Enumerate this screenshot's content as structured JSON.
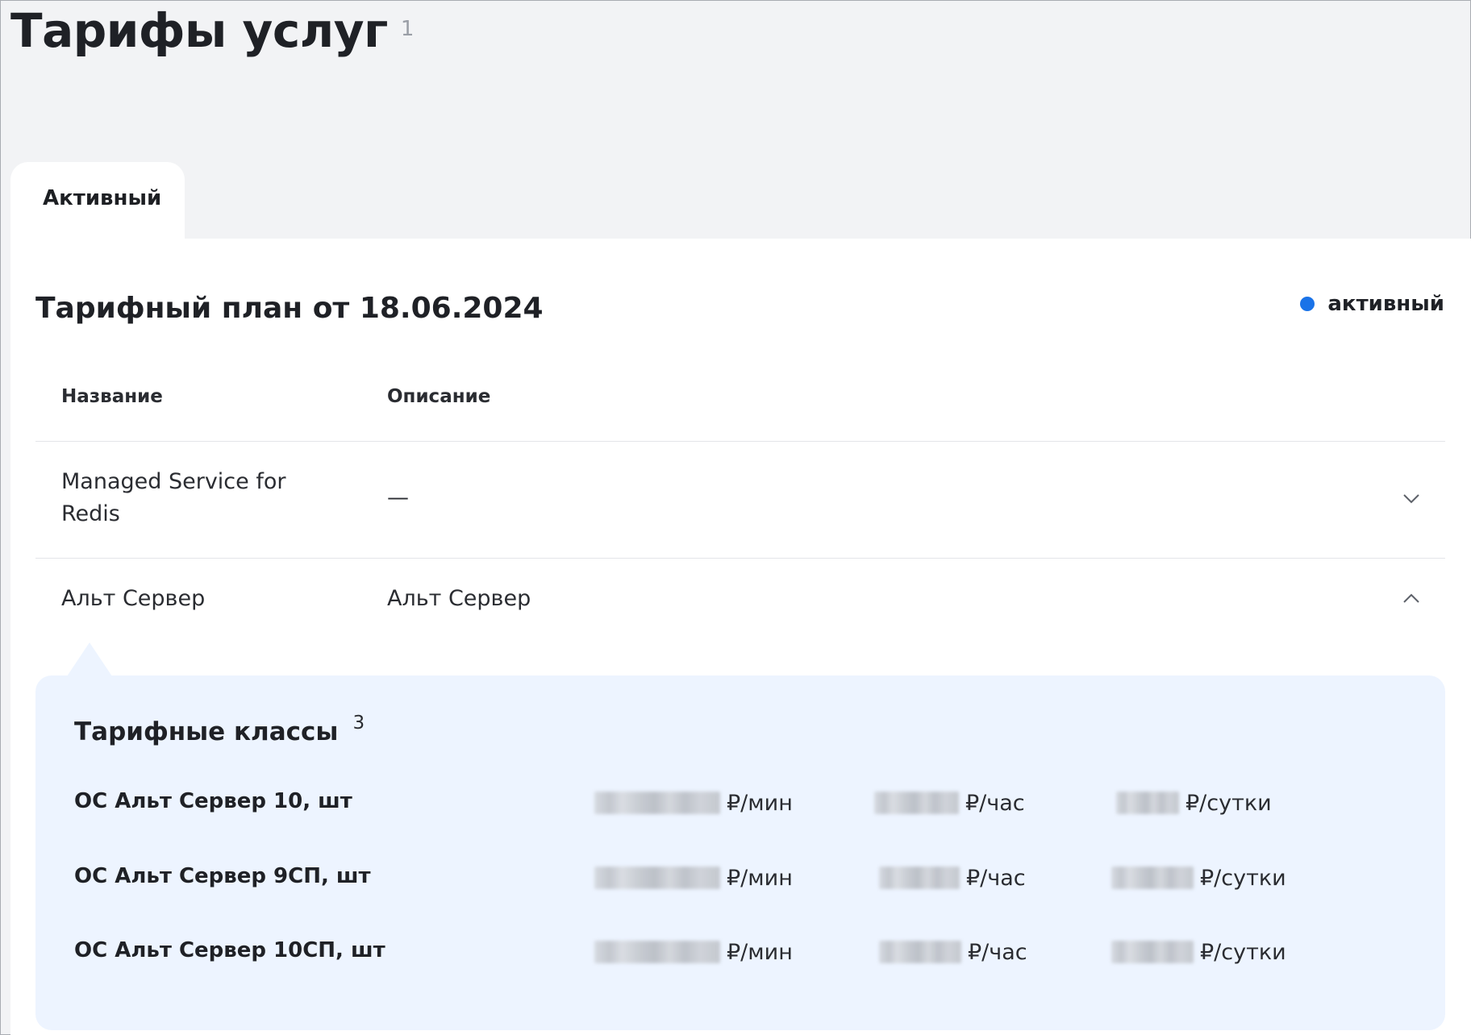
{
  "header": {
    "title": "Тарифы услуг",
    "count": "1"
  },
  "tabs": [
    {
      "label": "Активный",
      "active": true
    }
  ],
  "plan": {
    "title": "Тарифный план от 18.06.2024",
    "status": {
      "label": "активный",
      "color": "#1a73e8"
    }
  },
  "table": {
    "columns": {
      "name": "Название",
      "description": "Описание"
    },
    "rows": [
      {
        "name": "Managed Service for Redis",
        "description": "—",
        "expanded": false
      },
      {
        "name": "Альт Сервер",
        "description": "Альт Сервер",
        "expanded": true
      }
    ]
  },
  "tariff_classes": {
    "title": "Тарифные классы",
    "count": "3",
    "items": [
      {
        "name": "ОС Альт Сервер 10, шт",
        "per_min_unit": "₽/мин",
        "per_hour_unit": "₽/час",
        "per_day_unit": "₽/сутки"
      },
      {
        "name": "ОС Альт Сервер 9СП, шт",
        "per_min_unit": "₽/мин",
        "per_hour_unit": "₽/час",
        "per_day_unit": "₽/сутки"
      },
      {
        "name": "ОС Альт Сервер 10СП, шт",
        "per_min_unit": "₽/мин",
        "per_hour_unit": "₽/час",
        "per_day_unit": "₽/сутки"
      }
    ]
  },
  "icons": {
    "row1_toggle": "chevron-down-icon",
    "row2_toggle": "chevron-up-icon",
    "status": "status-dot-icon"
  }
}
